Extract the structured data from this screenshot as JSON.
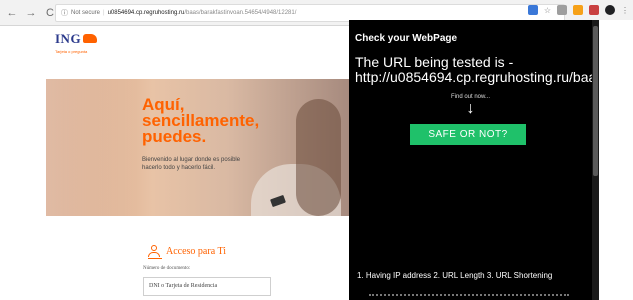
{
  "browser": {
    "security_label": "Not secure",
    "url_host": "u0854694.cp.regruhosting.ru",
    "url_path": "/baas/barakfastinvoan.54654/4948/12281/",
    "extension_colors": [
      "#3b78d8",
      "#9e9e9e",
      "#f6a118",
      "#c94040",
      "#202124"
    ]
  },
  "ing": {
    "logo_name": "ING",
    "logo_tagline": "Tarjeta o pregunta",
    "hero_lines": [
      "Aquí,",
      "sencillamente,",
      "puedes."
    ],
    "hero_body": "Bienvenido al lugar donde es posible hacerlo todo y hacerlo fácil.",
    "access_title": "Acceso para Ti",
    "doc_label": "Número de documento:",
    "doc_value": "DNI o Tarjeta de Residencia"
  },
  "popup": {
    "title": "Check your WebPage",
    "tested_line1": "The URL being tested is -",
    "tested_line2": "http://u0854694.cp.regruhosting.ru/baa",
    "find_out": "Find out now...",
    "arrow": "↓",
    "safe_button": "SAFE OR NOT?",
    "features": "1. Having IP address 2. URL Length 3. URL Shortening"
  }
}
